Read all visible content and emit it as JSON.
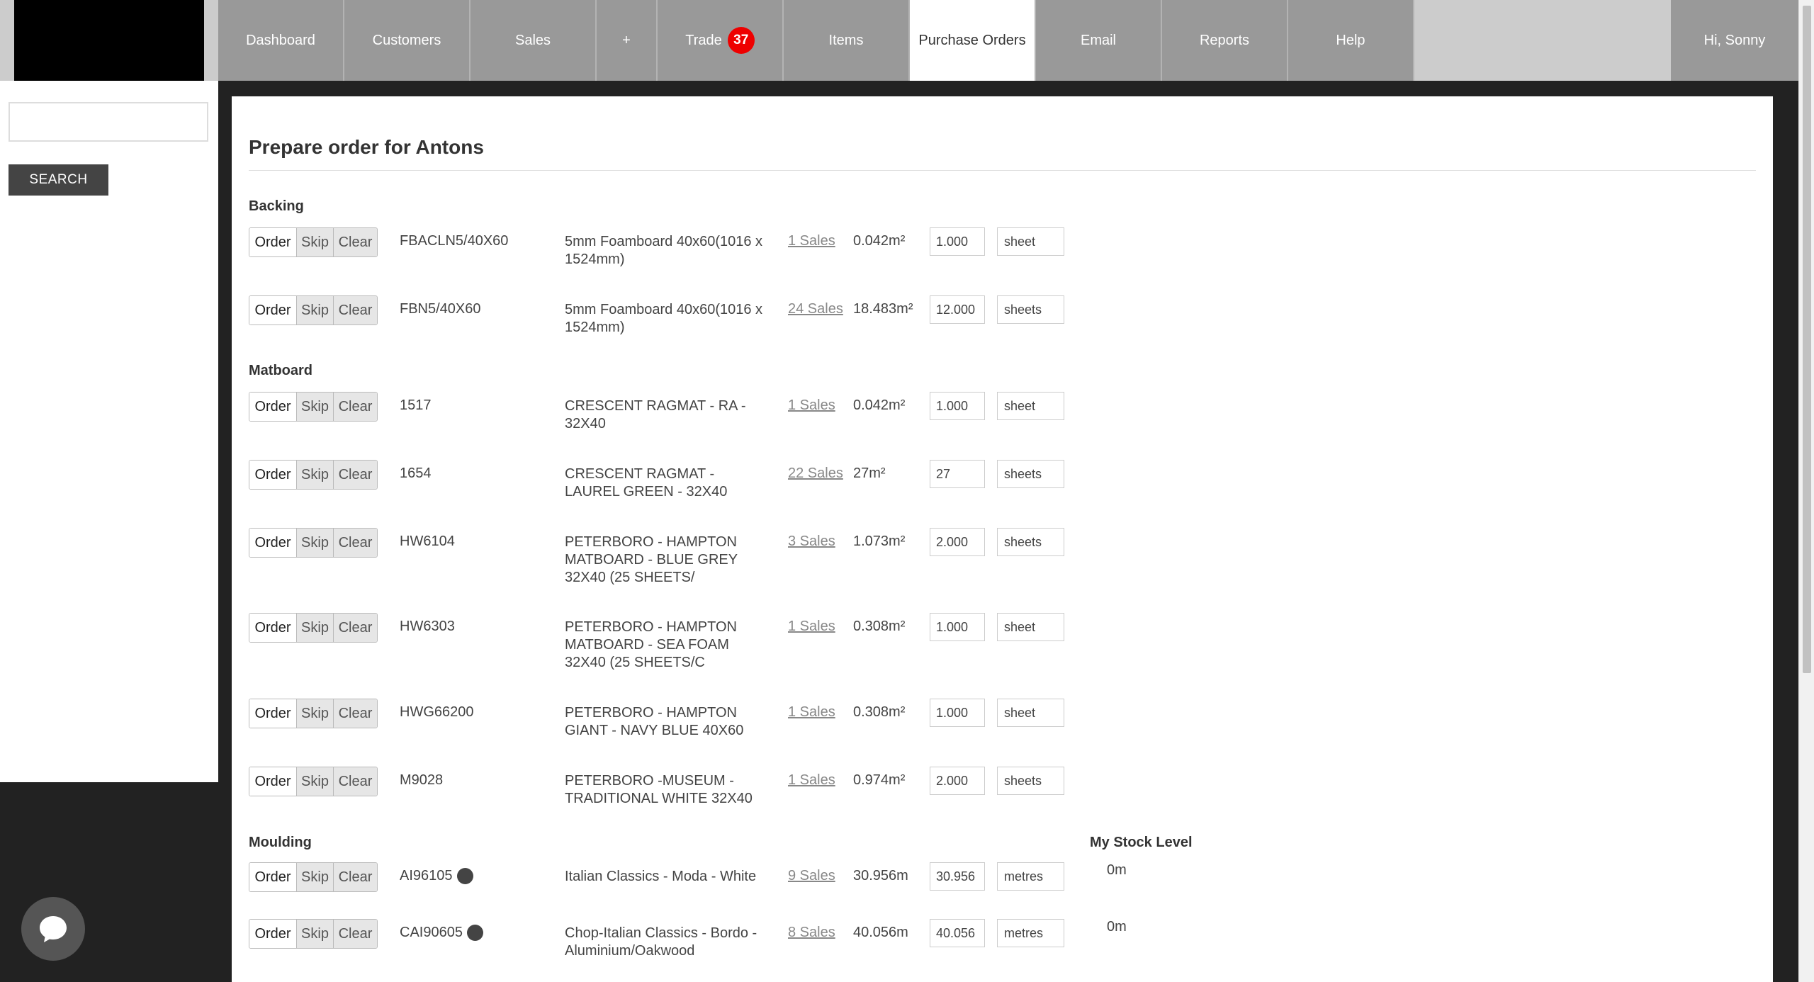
{
  "nav": {
    "items": [
      {
        "label": "Dashboard"
      },
      {
        "label": "Customers"
      },
      {
        "label": "Sales"
      },
      {
        "label": "+"
      },
      {
        "label": "Trade",
        "badge": "37"
      },
      {
        "label": "Items"
      },
      {
        "label": "Purchase Orders",
        "active": true
      },
      {
        "label": "Email"
      },
      {
        "label": "Reports"
      },
      {
        "label": "Help"
      }
    ],
    "user": "Hi, Sonny"
  },
  "sidebar": {
    "search_value": "",
    "search_button": "SEARCH"
  },
  "main": {
    "title": "Prepare order for Antons",
    "stock_header": "My Stock Level",
    "buttons": {
      "order": "Order",
      "skip": "Skip",
      "clear": "Clear"
    },
    "sections": [
      {
        "name": "Backing",
        "rows": [
          {
            "code": "FBACLN5/40X60",
            "desc": "5mm Foamboard 40x60(1016 x 1524mm)",
            "sales": "1 Sales",
            "qty": "0.042m²",
            "value": "1.000",
            "unit": "sheet"
          },
          {
            "code": "FBN5/40X60",
            "desc": "5mm Foamboard 40x60(1016 x 1524mm)",
            "sales": "24 Sales",
            "qty": "18.483m²",
            "value": "12.000",
            "unit": "sheets"
          }
        ]
      },
      {
        "name": "Matboard",
        "rows": [
          {
            "code": "1517",
            "desc": "CRESCENT RAGMAT - RA - 32X40",
            "sales": "1 Sales",
            "qty": "0.042m²",
            "value": "1.000",
            "unit": "sheet"
          },
          {
            "code": "1654",
            "desc": "CRESCENT RAGMAT - LAUREL GREEN - 32X40",
            "sales": "22 Sales",
            "qty": "27m²",
            "value": "27",
            "unit": "sheets"
          },
          {
            "code": "HW6104",
            "desc": "PETERBORO - HAMPTON MATBOARD - BLUE GREY 32X40 (25 SHEETS/",
            "sales": "3 Sales",
            "qty": "1.073m²",
            "value": "2.000",
            "unit": "sheets"
          },
          {
            "code": "HW6303",
            "desc": "PETERBORO - HAMPTON MATBOARD - SEA FOAM 32X40 (25 SHEETS/C",
            "sales": "1 Sales",
            "qty": "0.308m²",
            "value": "1.000",
            "unit": "sheet"
          },
          {
            "code": "HWG66200",
            "desc": "PETERBORO - HAMPTON GIANT - NAVY BLUE 40X60",
            "sales": "1 Sales",
            "qty": "0.308m²",
            "value": "1.000",
            "unit": "sheet"
          },
          {
            "code": "M9028",
            "desc": "PETERBORO -MUSEUM - TRADITIONAL WHITE 32X40",
            "sales": "1 Sales",
            "qty": "0.974m²",
            "value": "2.000",
            "unit": "sheets"
          }
        ]
      },
      {
        "name": "Moulding",
        "rows": [
          {
            "code": "AI96105",
            "desc": "Italian Classics - Moda - White",
            "sales": "9 Sales",
            "qty": "30.956m",
            "value": "30.956",
            "unit": "metres",
            "stock": "0m"
          },
          {
            "code": "CAI90605",
            "desc": "Chop-Italian Classics - Bordo - Aluminium/Oakwood",
            "sales": "8 Sales",
            "qty": "40.056m",
            "value": "40.056",
            "unit": "metres",
            "stock": "0m"
          }
        ]
      }
    ]
  }
}
